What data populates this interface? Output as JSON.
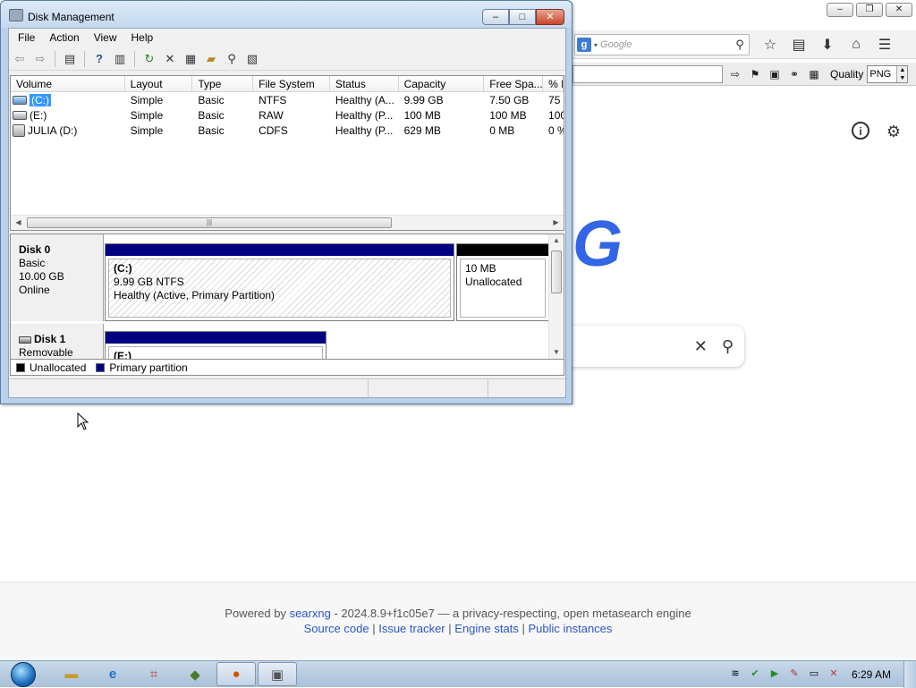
{
  "browser": {
    "window_controls": [
      "–",
      "❐",
      "✕"
    ],
    "search_placeholder": "Google",
    "quality_label": "Quality",
    "quality_value": "PNG",
    "logo_fragment": "G",
    "footer": {
      "powered_by": "Powered by",
      "searxng": "searxng",
      "version_text": "- 2024.8.9+f1c05e7 — a privacy-respecting, open metasearch engine",
      "links": [
        "Source code",
        "Issue tracker",
        "Engine stats",
        "Public instances"
      ],
      "sep": "|"
    }
  },
  "dm": {
    "title": "Disk Management",
    "menu": [
      "File",
      "Action",
      "View",
      "Help"
    ],
    "columns": [
      "Volume",
      "Layout",
      "Type",
      "File System",
      "Status",
      "Capacity",
      "Free Spa...",
      "% F"
    ],
    "volumes": [
      {
        "volume": "(C:)",
        "layout": "Simple",
        "type": "Basic",
        "fs": "NTFS",
        "status": "Healthy (A...",
        "capacity": "9.99 GB",
        "free": "7.50 GB",
        "pct": "75"
      },
      {
        "volume": "(E:)",
        "layout": "Simple",
        "type": "Basic",
        "fs": "RAW",
        "status": "Healthy (P...",
        "capacity": "100 MB",
        "free": "100 MB",
        "pct": "100"
      },
      {
        "volume": "JULIA (D:)",
        "layout": "Simple",
        "type": "Basic",
        "fs": "CDFS",
        "status": "Healthy (P...",
        "capacity": "629 MB",
        "free": "0 MB",
        "pct": "0 %"
      }
    ],
    "disks": [
      {
        "name": "Disk 0",
        "kind": "Basic",
        "size": "10.00 GB",
        "state": "Online",
        "partitions": [
          {
            "name": "(C:)",
            "line2": "9.99 GB NTFS",
            "line3": "Healthy (Active, Primary Partition)"
          },
          {
            "name": "",
            "line2": "10 MB",
            "line3": "Unallocated"
          }
        ]
      },
      {
        "name": "Disk 1",
        "kind": "Removable",
        "size": "",
        "state": "",
        "partitions": [
          {
            "name": "(E:)",
            "line2": "",
            "line3": ""
          }
        ]
      }
    ],
    "legend": [
      "Unallocated",
      "Primary partition"
    ],
    "legend_colors": [
      "#000000",
      "#000080"
    ]
  },
  "taskbar": {
    "clock": "6:29 AM",
    "items": [
      "explorer-icon",
      "ie-icon",
      "network-icon",
      "media-icon",
      "firefox-icon",
      "disk-management-icon"
    ]
  }
}
